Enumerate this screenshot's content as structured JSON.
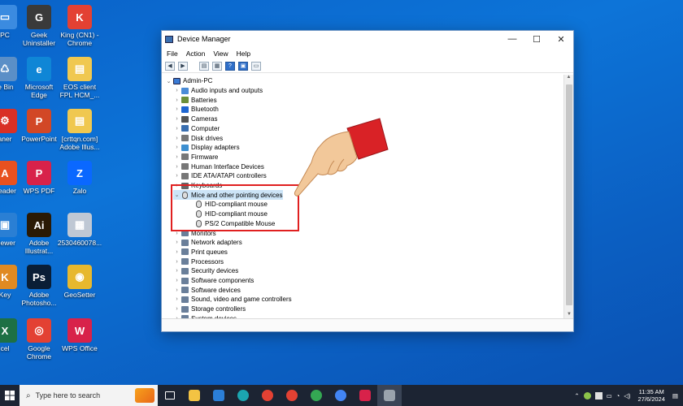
{
  "desktop": {
    "icons": [
      {
        "label": "PC",
        "color": "#3b8be0",
        "glyph": "▭"
      },
      {
        "label": "Geek Uninstaller",
        "color": "#3a3a3a",
        "glyph": "G"
      },
      {
        "label": "King (CN1) - Chrome",
        "color": "#e34133",
        "glyph": "K"
      },
      {
        "label": "le Bin",
        "color": "#5b8fc7",
        "glyph": "♺"
      },
      {
        "label": "Microsoft Edge",
        "color": "#0f86d6",
        "glyph": "e"
      },
      {
        "label": "EOS client FPL HCM_...",
        "color": "#f0c850",
        "glyph": "▤"
      },
      {
        "label": "aner",
        "color": "#d93025",
        "glyph": "⚙"
      },
      {
        "label": "PowerPoint",
        "color": "#d24726",
        "glyph": "P"
      },
      {
        "label": "[crttqn.com] Adobe Illus...",
        "color": "#f0c850",
        "glyph": "▤"
      },
      {
        "label": "Reader",
        "color": "#e8511f",
        "glyph": "A"
      },
      {
        "label": "WPS PDF",
        "color": "#d8224a",
        "glyph": "P"
      },
      {
        "label": "Zalo",
        "color": "#0a68ff",
        "glyph": "Z"
      },
      {
        "label": "Viewer",
        "color": "#2a7fd4",
        "glyph": "▣"
      },
      {
        "label": "Adobe Illustrat...",
        "color": "#2a1a05",
        "glyph": "Ai"
      },
      {
        "label": "2530460078...",
        "color": "#bfc8d4",
        "glyph": "▦"
      },
      {
        "label": "Key",
        "color": "#e08a22",
        "glyph": "K"
      },
      {
        "label": "Adobe Photosho...",
        "color": "#0a1e36",
        "glyph": "Ps"
      },
      {
        "label": "GeoSetter",
        "color": "#e7b82e",
        "glyph": "◉"
      },
      {
        "label": "cel",
        "color": "#1d7044",
        "glyph": "X"
      },
      {
        "label": "Google Chrome",
        "color": "#e34133",
        "glyph": "◎"
      },
      {
        "label": "WPS Office",
        "color": "#d8224a",
        "glyph": "W"
      }
    ]
  },
  "window": {
    "title": "Device Manager",
    "controls": {
      "minimize": "—",
      "maximize": "☐",
      "close": "✕"
    },
    "menu": [
      "File",
      "Action",
      "View",
      "Help"
    ],
    "toolbar": [
      "back",
      "forward",
      "properties",
      "refresh",
      "help",
      "scan"
    ],
    "tree": {
      "root": "Admin-PC",
      "categories": [
        "Audio inputs and outputs",
        "Batteries",
        "Bluetooth",
        "Cameras",
        "Computer",
        "Disk drives",
        "Display adapters",
        "Firmware",
        "Human Interface Devices",
        "IDE ATA/ATAPI controllers",
        "Keyboards"
      ],
      "expanded": {
        "label": "Mice and other pointing devices",
        "children": [
          "HID-compliant mouse",
          "HID-compliant mouse",
          "PS/2 Compatible Mouse"
        ]
      },
      "categories_after": [
        "Monitors",
        "Network adapters",
        "Print queues",
        "Processors",
        "Security devices",
        "Software components",
        "Software devices",
        "Sound, video and game controllers",
        "Storage controllers",
        "System devices"
      ]
    }
  },
  "taskbar": {
    "search_placeholder": "Type here to search",
    "time": "11:35 AM",
    "date": "27/6/2024",
    "colors": {
      "highlight": "#e02020",
      "selection": "#cce4f7"
    }
  }
}
